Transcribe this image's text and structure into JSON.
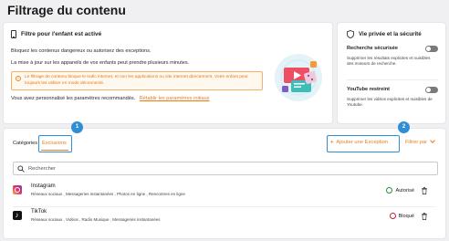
{
  "page": {
    "title": "Filtrage du contenu"
  },
  "child_filter": {
    "title": "Filtre pour l'enfant est activé",
    "description": "Bloquez les contenus dangereux ou autorisez des exceptions.",
    "update_note": "La mise à jour sur les appareils de vos enfants peut prendre plusieurs minutes.",
    "warning": "Le filtrage de contenu bloque le trafic internet, et non les applications ou site internet directement. Votre enfant peut toujours les utiliser en mode déconnecté.",
    "recommendation": "Vous avez personnalisé les paramètres recommandés.",
    "restore_link": "Rétablir les paramètres initiaux"
  },
  "privacy": {
    "title": "Vie privée et la sécurité",
    "items": [
      {
        "title": "Recherche sécurisée",
        "description": "Supprimer les résultats explicites et nuisibles des moteurs de recherche.",
        "enabled": false
      },
      {
        "title": "YouTube restreint",
        "description": "Supprimer les vidéos explicites et nuisibles de Youtube.",
        "enabled": false
      }
    ]
  },
  "exceptions": {
    "tabs": [
      {
        "label": "Catégories"
      },
      {
        "label": "Exclusions"
      }
    ],
    "active_tab": "Exclusions",
    "badges": [
      "1",
      "2"
    ],
    "add_button": "Ajouter une Exception",
    "add_icon": "+",
    "filter_button": "Filtrer par",
    "search": {
      "placeholder": "Rechercher",
      "value": ""
    },
    "apps": [
      {
        "name": "Instagram",
        "categories": "Réseaux sociaux , Messageries instantanées , Photos en ligne , Rencontres en ligne",
        "status": "Autorisé",
        "status_color": "#2d8a3e",
        "icon": "instagram-icon"
      },
      {
        "name": "TikTok",
        "categories": "Réseaux sociaux , Vidéos , Radio Musique , Messageries instantanées",
        "status": "Bloqué",
        "status_color": "#c0223a",
        "icon": "tiktok-icon"
      }
    ]
  },
  "colors": {
    "accent": "#ea7c1b",
    "highlight": "#2e8fd6",
    "allowed": "#2d8a3e",
    "blocked": "#c0223a"
  }
}
